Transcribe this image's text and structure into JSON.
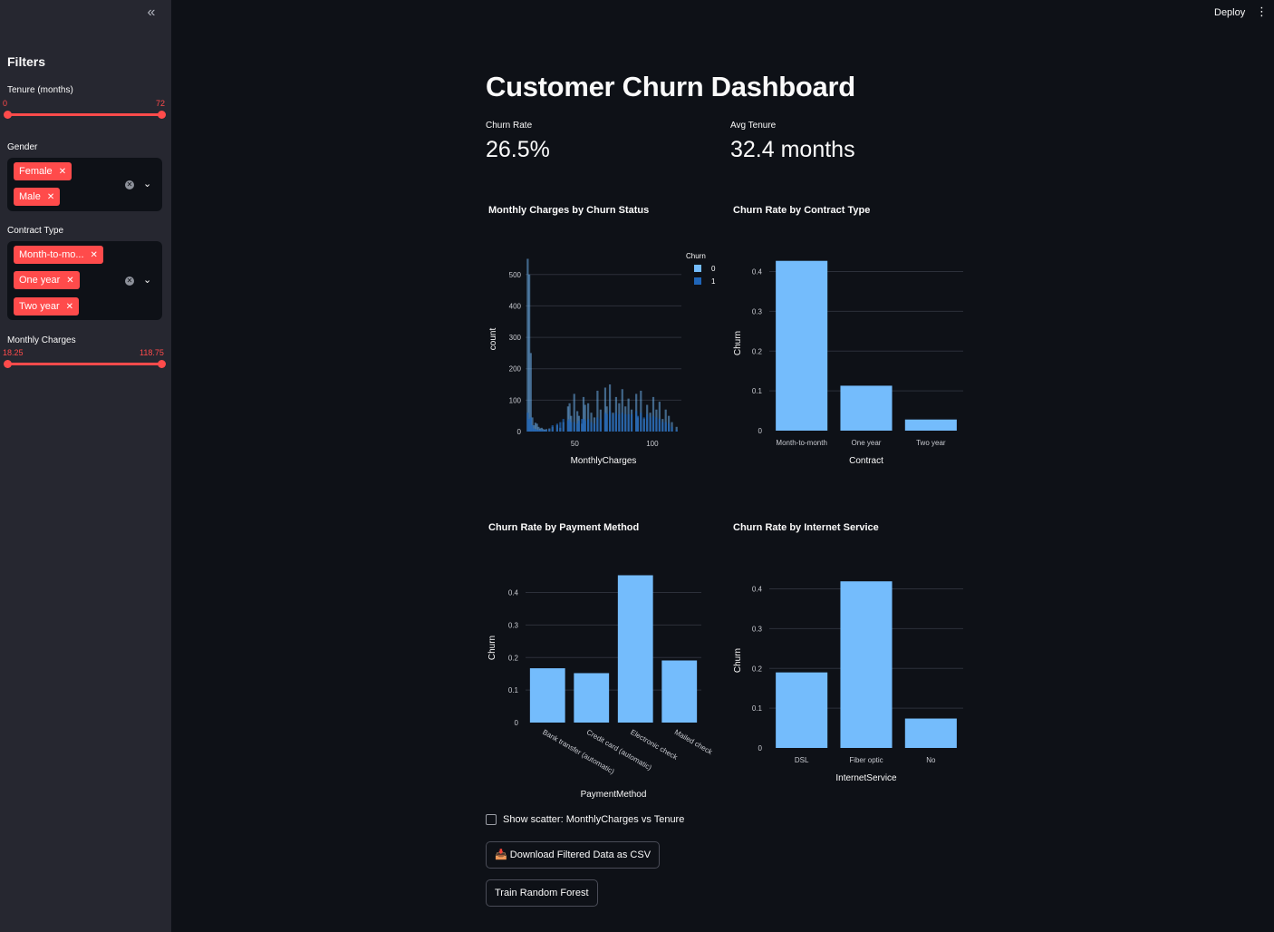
{
  "header": {
    "deploy_label": "Deploy",
    "menu_icon": "⋮",
    "collapse_icon": "«"
  },
  "sidebar": {
    "title": "Filters",
    "tenure": {
      "label": "Tenure (months)",
      "min": "0",
      "max": "72"
    },
    "gender": {
      "label": "Gender",
      "tags": [
        "Female",
        "Male"
      ]
    },
    "contract": {
      "label": "Contract Type",
      "tags": [
        "Month-to-mo...",
        "One year",
        "Two year"
      ]
    },
    "monthly_charges": {
      "label": "Monthly Charges",
      "min": "18.25",
      "max": "118.75"
    }
  },
  "main": {
    "title": "Customer Churn Dashboard",
    "metrics": [
      {
        "label": "Churn Rate",
        "value": "26.5%"
      },
      {
        "label": "Avg Tenure",
        "value": "32.4 months"
      }
    ],
    "checkbox_label": "Show scatter: MonthlyCharges vs Tenure",
    "download_button": "📥 Download Filtered Data as CSV",
    "train_button": "Train Random Forest"
  },
  "colors": {
    "accent": "#ff4b4b",
    "bar": "#74bcfc",
    "bar_dark": "#1f65b8",
    "background": "#0e1117",
    "sidebar": "#262730"
  },
  "chart_data": [
    {
      "type": "bar",
      "title": "Monthly Charges by Churn Status",
      "xlabel": "MonthlyCharges",
      "ylabel": "count",
      "xlim": [
        18.25,
        118.75
      ],
      "ylim": [
        0,
        560
      ],
      "yticks": [
        0,
        100,
        200,
        300,
        400,
        500
      ],
      "xticks": [
        50,
        100
      ],
      "legend_title": "Churn",
      "x": [
        19,
        20,
        21,
        22,
        23,
        24,
        25,
        26,
        27,
        28,
        29,
        30,
        31,
        33,
        35,
        38,
        40,
        42,
        45,
        46,
        47,
        49,
        51,
        52,
        54,
        55,
        56,
        58,
        60,
        62,
        64,
        66,
        69,
        70,
        72,
        74,
        76,
        78,
        80,
        82,
        84,
        86,
        89,
        90,
        92,
        94,
        96,
        98,
        100,
        102,
        104,
        106,
        108,
        110,
        112,
        115
      ],
      "series": [
        {
          "name": "0",
          "values": [
            550,
            500,
            250,
            45,
            20,
            28,
            25,
            15,
            10,
            12,
            8,
            6,
            8,
            10,
            15,
            20,
            12,
            30,
            80,
            90,
            50,
            120,
            65,
            50,
            25,
            110,
            85,
            90,
            60,
            45,
            130,
            70,
            140,
            80,
            150,
            60,
            110,
            90,
            135,
            80,
            105,
            70,
            120,
            45,
            130,
            40,
            85,
            60,
            110,
            70,
            95,
            40,
            70,
            50,
            30,
            15
          ]
        },
        {
          "name": "1",
          "values": [
            60,
            40,
            45,
            20,
            10,
            8,
            6,
            5,
            5,
            5,
            4,
            3,
            5,
            8,
            20,
            25,
            30,
            40,
            35,
            40,
            30,
            30,
            25,
            35,
            40,
            40,
            35,
            40,
            30,
            25,
            45,
            40,
            60,
            55,
            65,
            55,
            60,
            55,
            60,
            55,
            55,
            55,
            65,
            50,
            60,
            45,
            55,
            45,
            50,
            45,
            40,
            30,
            30,
            25,
            15,
            5
          ]
        }
      ]
    },
    {
      "type": "bar",
      "title": "Churn Rate by Contract Type",
      "categories": [
        "Month-to-month",
        "One year",
        "Two year"
      ],
      "values": [
        0.427,
        0.113,
        0.028
      ],
      "xlabel": "Contract",
      "ylabel": "Churn",
      "ylim": [
        0,
        0.44
      ],
      "yticks": [
        0,
        0.1,
        0.2,
        0.3,
        0.4
      ]
    },
    {
      "type": "bar",
      "title": "Churn Rate by Payment Method",
      "categories": [
        "Bank transfer (automatic)",
        "Credit card (automatic)",
        "Electronic check",
        "Mailed check"
      ],
      "values": [
        0.167,
        0.152,
        0.453,
        0.191
      ],
      "xlabel": "PaymentMethod",
      "ylabel": "Churn",
      "ylim": [
        0,
        0.46
      ],
      "yticks": [
        0,
        0.1,
        0.2,
        0.3,
        0.4
      ]
    },
    {
      "type": "bar",
      "title": "Churn Rate by Internet Service",
      "categories": [
        "DSL",
        "Fiber optic",
        "No"
      ],
      "values": [
        0.19,
        0.419,
        0.074
      ],
      "xlabel": "InternetService",
      "ylabel": "Churn",
      "ylim": [
        0,
        0.44
      ],
      "yticks": [
        0,
        0.1,
        0.2,
        0.3,
        0.4
      ]
    }
  ]
}
